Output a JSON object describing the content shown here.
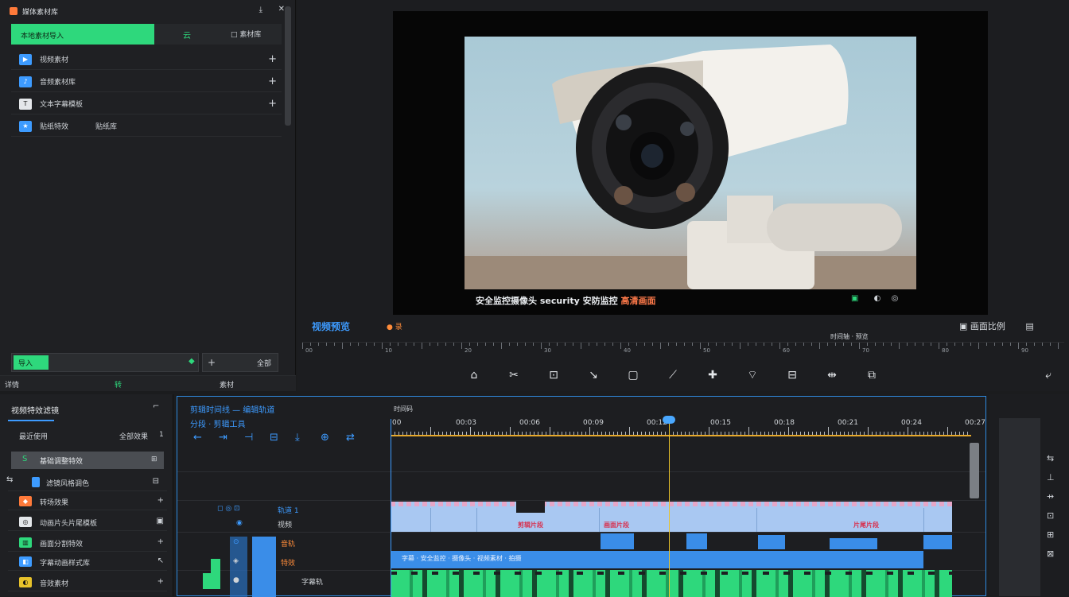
{
  "media_panel": {
    "header_title": "媒体素材库",
    "pin_icon": "pin-icon",
    "close_icon": "close-icon",
    "tabs": {
      "active": "本地素材导入",
      "second": "云",
      "third": "□ 素材库"
    },
    "rows": [
      {
        "label": "视频素材",
        "icon": "video-icon",
        "color": "#3d9bff",
        "has_plus": true
      },
      {
        "label": "音频素材库",
        "icon": "audio-icon",
        "color": "#3d9bff",
        "has_plus": true
      },
      {
        "label": "文本字幕模板",
        "icon": "text-icon",
        "color": "#e4e7ea",
        "has_plus": true
      },
      {
        "label": "贴纸特效",
        "icon": "sticker-icon",
        "color": "#3d9bff",
        "extra": "贴纸库"
      }
    ],
    "import_button": "导入",
    "import_diamond": "◆",
    "import_arrow": "+",
    "import_right": "全部",
    "footer": [
      "详情",
      "转",
      "素材"
    ]
  },
  "preview": {
    "caption_main": "安全监控摄像头 security 安防监控 ",
    "caption_highlight": "高清画面",
    "icons": [
      "▣",
      "◐",
      "◎"
    ],
    "title": "视频预览",
    "badge": "● 录",
    "right_text": "▣ 画面比例",
    "right_icon": "▤",
    "ruler_label": "时间轴 · 预览",
    "ruler_labels": [
      "00",
      "10",
      "20",
      "30",
      "40",
      "50",
      "60",
      "70",
      "80",
      "90"
    ],
    "toolbar": [
      "⌂",
      "✂",
      "⊡",
      "↘",
      "▢",
      "⟋",
      "✚",
      "⌔",
      "⊟",
      "⇹",
      "⧉",
      "⤶"
    ]
  },
  "effects_panel": {
    "title": "视频特效滤镜",
    "close": "⌐",
    "row0": {
      "left": "最近使用",
      "mid": "全部效果",
      "right": "1"
    },
    "selected": {
      "label": "基础调整特效",
      "badge": "S",
      "right": "⊞"
    },
    "rows": [
      {
        "label": "滤镜风格调色",
        "icon": "filter-icon",
        "color": "#3d9bff",
        "right": "⊟"
      },
      {
        "label": "转场效果",
        "icon": "transition-icon",
        "color": "#ff7a3a",
        "right": "+"
      },
      {
        "label": "动画片头片尾模板",
        "icon": "animation-icon",
        "color": "#e4e7ea",
        "right": "▣"
      },
      {
        "label": "画面分割特效",
        "icon": "split-icon",
        "color": "#2ed87c",
        "right": "+"
      },
      {
        "label": "字幕动画样式库",
        "icon": "subtitle-icon",
        "color": "#3d9bff",
        "right": "↖"
      },
      {
        "label": "音效素材",
        "icon": "sound-icon",
        "color": "#e7c22b",
        "right": "+"
      }
    ]
  },
  "timeline": {
    "title1": "剪辑时间线 — 编辑轨道",
    "title2": "分段 · 剪辑工具",
    "tools": [
      "←",
      "⇥",
      "⊣",
      "⊟",
      "⤓",
      "⊕",
      "⇄"
    ],
    "ruler_label": "时间码",
    "ruler_labels": [
      "00",
      "00:03",
      "00:06",
      "00:09",
      "00:12",
      "00:15",
      "00:18",
      "00:21",
      "00:24",
      "00:27"
    ],
    "track_labels": [
      {
        "a": "◻ ◎ ⊡",
        "b": "轨道 1"
      },
      {
        "a": "◉",
        "b": "视频"
      },
      {
        "a": "⊙",
        "b": "音轨"
      },
      {
        "a": "◈",
        "b": "特效"
      },
      {
        "a": "●",
        "b": "字幕轨"
      }
    ],
    "clip_labels": [
      "剪辑片段",
      "画面片段",
      "片尾片段"
    ],
    "subtitle_text": "字幕 · 安全监控 · 摄像头 · 视频素材 · 拍摄"
  },
  "right_panel": {
    "icons": [
      "⇆",
      "⊥",
      "⇸",
      "⊡",
      "⊞",
      "⊠"
    ]
  }
}
